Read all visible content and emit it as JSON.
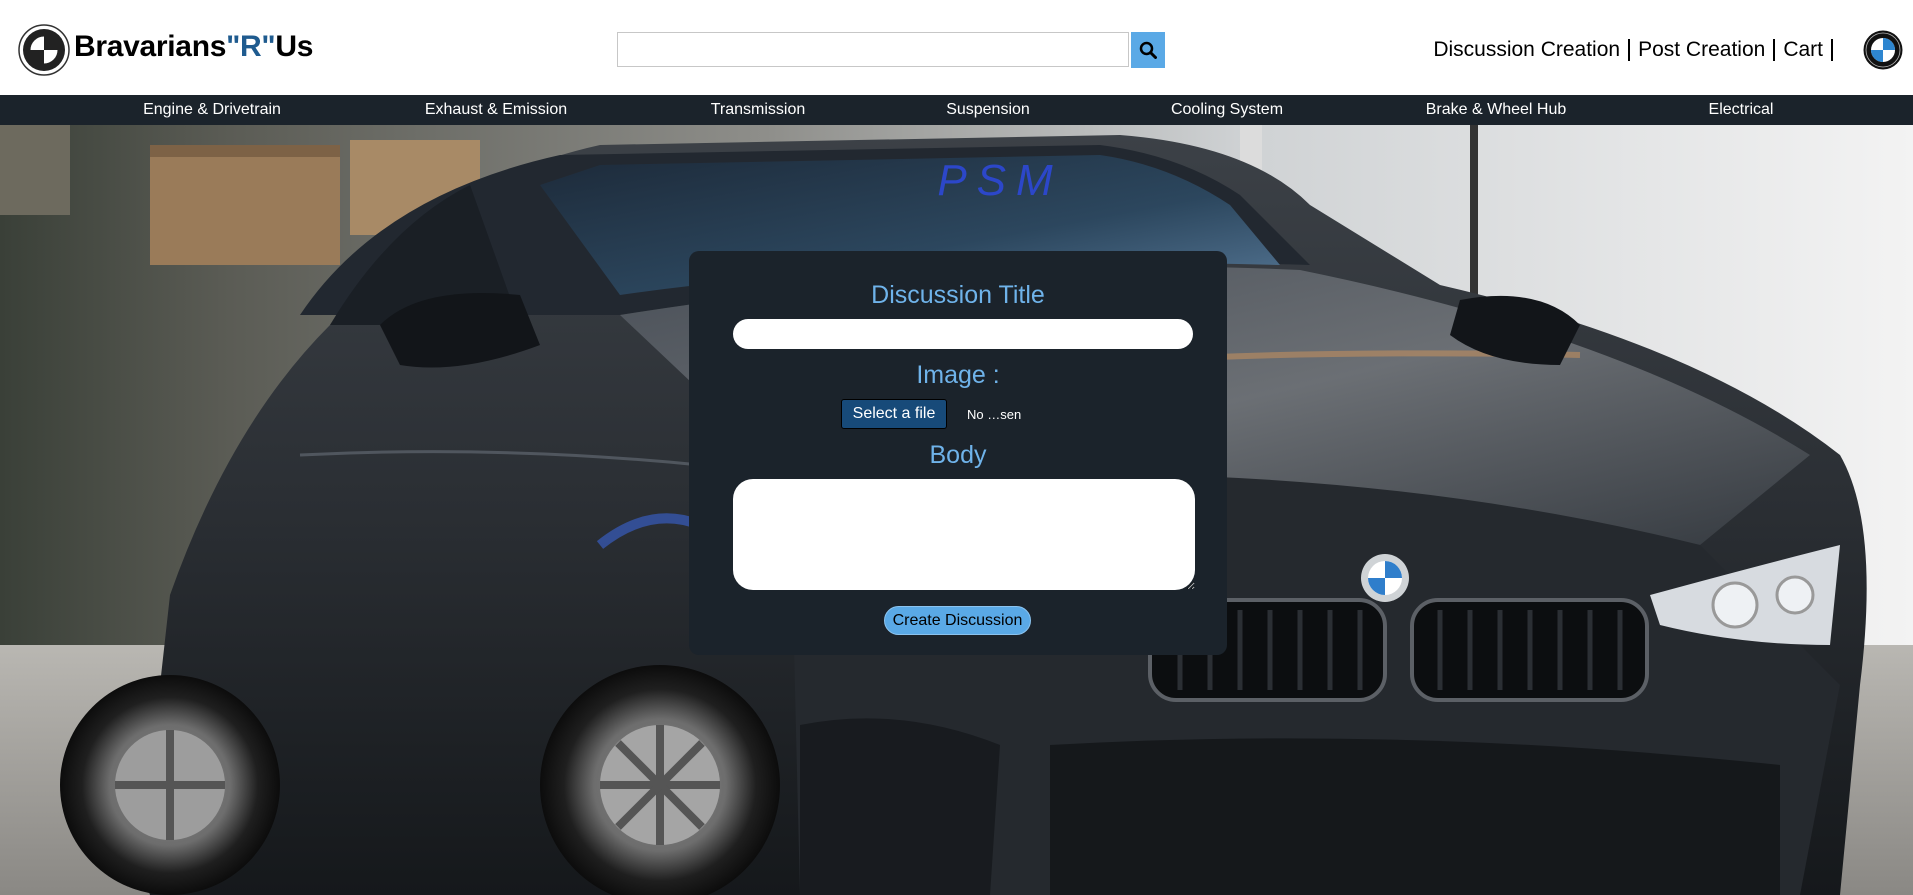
{
  "header": {
    "brand_part1": "Bravarians",
    "brand_part2": "\"R\"",
    "brand_part3": "Us",
    "search_placeholder": "",
    "search_icon": "search-icon",
    "links": {
      "discussion_creation": "Discussion Creation",
      "post_creation": "Post Creation",
      "cart": "Cart"
    },
    "logo_icon": "roundel-logo-icon"
  },
  "nav": {
    "items": [
      "Engine & Drivetrain",
      "Exhaust & Emission",
      "Transmission",
      "Suspension",
      "Cooling System",
      "Brake & Wheel Hub",
      "Electrical"
    ]
  },
  "hero": {
    "windshield_banner": "PSM"
  },
  "form": {
    "title_label": "Discussion Title",
    "title_value": "",
    "image_label": "Image :",
    "file_button": "Select a file",
    "file_status": "No …sen",
    "body_label": "Body",
    "body_value": "",
    "submit_label": "Create Discussion"
  },
  "colors": {
    "nav_bg": "#1b232b",
    "panel_bg": "#1b232b",
    "accent": "#5aa9e6",
    "label": "#6fb3ea",
    "file_button": "#174a79",
    "brand_r": "#1f5b8f"
  }
}
